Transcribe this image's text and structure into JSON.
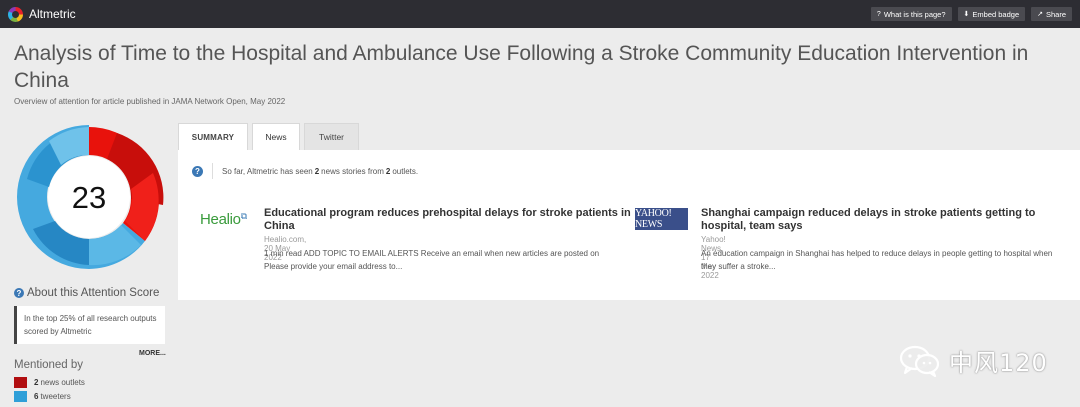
{
  "app": {
    "name": "Altmetric"
  },
  "top_actions": [
    {
      "icon": "question-icon",
      "label": "What is this page?"
    },
    {
      "icon": "download-icon",
      "label": "Embed badge"
    },
    {
      "icon": "share-icon",
      "label": "Share"
    }
  ],
  "article": {
    "title": "Analysis of Time to the Hospital and Ambulance Use Following a Stroke Community Education Intervention in China",
    "subtitle": "Overview of attention for article published in JAMA Network Open, May 2022"
  },
  "score": {
    "value": "23",
    "about_label": "About this Attention Score",
    "note": "In the top 25% of all research outputs scored by Altmetric",
    "more_label": "MORE...",
    "colors": {
      "news": "#e8120c",
      "twitter": "#2f9fd8"
    }
  },
  "mentioned": {
    "heading": "Mentioned by",
    "items": [
      {
        "count": "2",
        "label": "news outlets",
        "color": "#b10e10"
      },
      {
        "count": "6",
        "label": "tweeters",
        "color": "#2f9fd8"
      }
    ]
  },
  "tabs": [
    {
      "label": "SUMMARY"
    },
    {
      "label": "News"
    },
    {
      "label": "Twitter"
    }
  ],
  "news": {
    "info_pre": "So far, Altmetric has seen",
    "stories_count": "2",
    "info_mid": "news stories from",
    "outlets_count": "2",
    "info_post": "outlets.",
    "stories": [
      {
        "logo": "Healio",
        "headline": "Educational program reduces prehospital delays for stroke patients in China",
        "source": "Healio.com, 20 May 2022",
        "snippet": "1 min read ADD TOPIC TO EMAIL ALERTS Receive an email when new articles are posted on Please provide your email address to..."
      },
      {
        "logo": "YAHOO! NEWS",
        "headline": "Shanghai campaign reduced delays in stroke patients getting to hospital, team says",
        "source": "Yahoo! News, 17 May 2022",
        "snippet": "An education campaign in Shanghai has helped to reduce delays in people getting to hospital when they suffer a stroke..."
      }
    ]
  },
  "watermark": {
    "text": "中风120"
  }
}
